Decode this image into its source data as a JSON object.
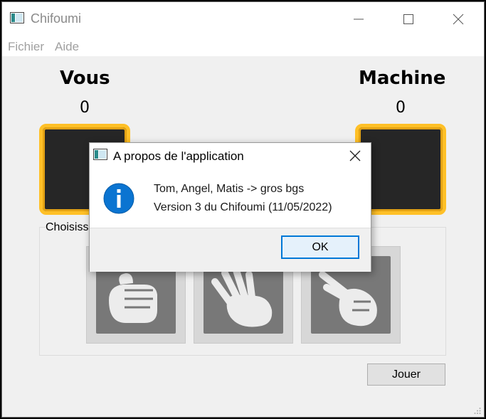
{
  "window": {
    "title": "Chifoumi",
    "controls": [
      "minimize-icon",
      "maximize-icon",
      "close-icon"
    ]
  },
  "menu": {
    "items": [
      "Fichier",
      "Aide"
    ]
  },
  "game": {
    "player": {
      "label": "Vous",
      "score": "0"
    },
    "machine": {
      "label": "Machine",
      "score": "0"
    },
    "choices_title": "Choisisse",
    "choices": [
      "pierre-icon",
      "feuille-icon",
      "ciseau-icon"
    ],
    "play_button": "Jouer"
  },
  "dialog": {
    "title": "A propos de l'application",
    "icon": "info-icon",
    "line1": "Tom, Angel, Matis -> gros bgs",
    "line2": "Version 3 du Chifoumi (11/05/2022)",
    "ok_label": "OK"
  },
  "colors": {
    "slot_border": "#ffc027",
    "slot_fill": "#262626",
    "ok_border": "#0078d7",
    "info_blue": "#0a74d1"
  }
}
